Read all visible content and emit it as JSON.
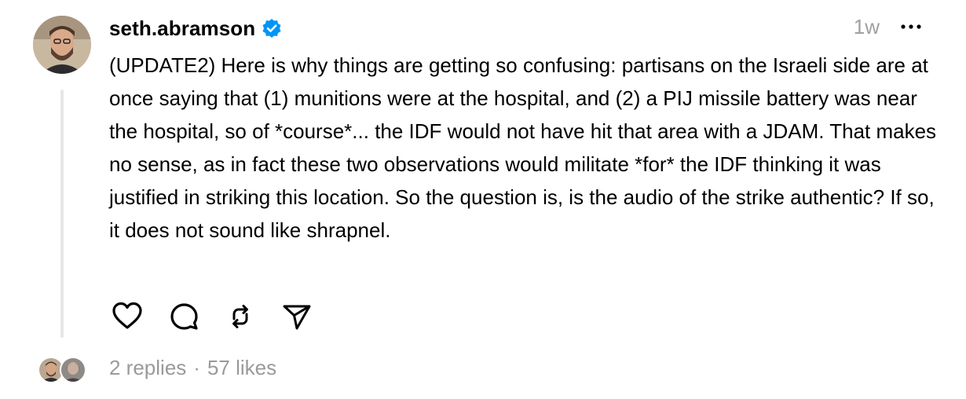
{
  "post": {
    "username": "seth.abramson",
    "verified_icon": "verified-badge-icon",
    "timestamp": "1w",
    "more_icon": "more-options-icon",
    "text": "(UPDATE2) Here is why things are getting so confusing: partisans on the Israeli side are at once saying that (1) munitions were at the hospital, and (2) a PIJ missile battery was near the hospital, so of *course*... the IDF would not have hit that area with a JDAM. That makes no sense, as in fact these two observations would militate *for* the IDF thinking it was justified in striking this location. So the question is, is the audio of the strike authentic? If so, it does not sound like shrapnel."
  },
  "actions": [
    {
      "icon": "heart-icon"
    },
    {
      "icon": "comment-icon"
    },
    {
      "icon": "repost-icon"
    },
    {
      "icon": "share-icon"
    }
  ],
  "footer": {
    "replies": "2 replies",
    "separator": "·",
    "likes": "57 likes"
  },
  "colors": {
    "text": "#000000",
    "muted": "#9a9a9a",
    "verified": "#0095f6",
    "thread_line": "#e6e6e6"
  }
}
